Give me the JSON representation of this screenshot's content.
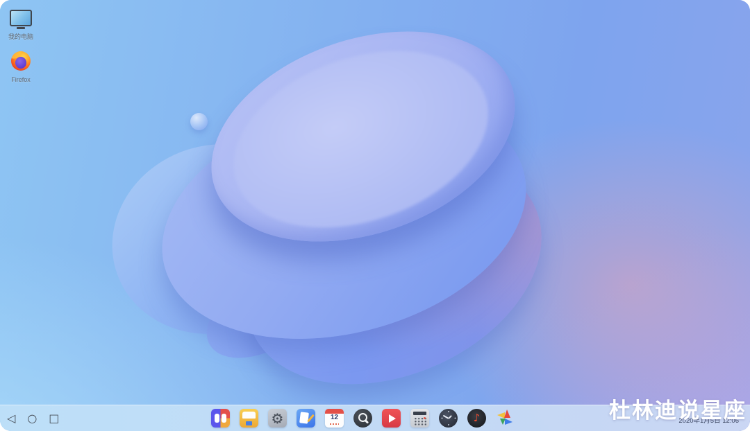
{
  "desktop": {
    "icons": [
      {
        "name": "my-computer",
        "label": "我的电脑"
      },
      {
        "name": "firefox",
        "label": "Firefox"
      }
    ]
  },
  "taskbar": {
    "nav_back": "◁",
    "nav_home": "○",
    "nav_recents": "□",
    "apps": [
      "app-launcher",
      "file-manager",
      "settings",
      "text-editor",
      "calendar",
      "search",
      "video-player",
      "calculator",
      "clock",
      "music",
      "pinwheel"
    ],
    "calendar_day": "12",
    "settings_glyph": "⚙",
    "music_glyph": "♪",
    "clock_text": "2020年1月5日 12:06"
  },
  "watermark": {
    "text": "杜林迪说星座"
  },
  "colors": {
    "taskbar_bg": "#c3e2f8",
    "wallpaper_top_left": "#8ec5f3",
    "wallpaper_top_right": "#7ea4ee",
    "wallpaper_bottom_left": "#acdcfa",
    "wallpaper_bottom_right": "#b5a7e6",
    "disc_blue": "#8aa6f2",
    "accent_pink": "#e0a2b8",
    "nav_icon": "#454b54",
    "watermark_text": "#ffffff"
  }
}
